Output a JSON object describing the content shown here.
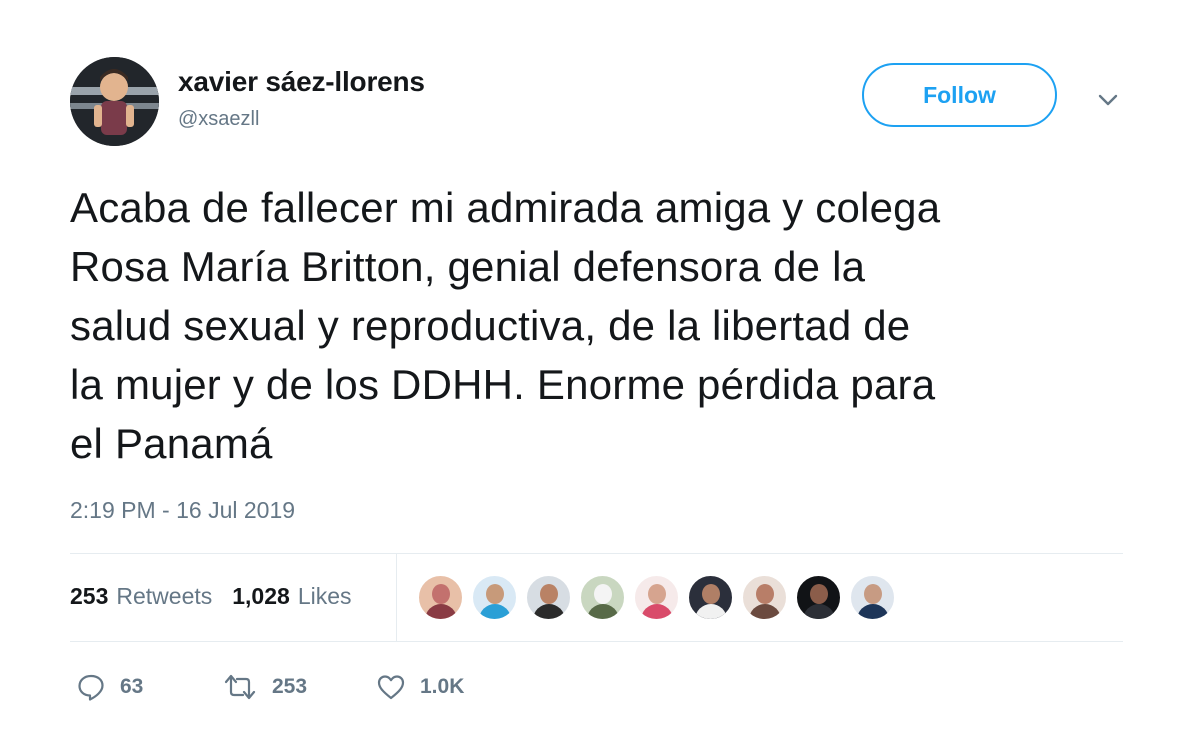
{
  "user": {
    "name": "xavier sáez-llorens",
    "handle": "@xsaezll"
  },
  "follow_label": "Follow",
  "tweet": {
    "text": "Acaba de fallecer mi admirada amiga y colega\nRosa María Britton, genial defensora de la\nsalud sexual y reproductiva, de la libertad de\nla mujer y de los DDHH. Enorme pérdida para\nel Panamá",
    "timestamp": "2:19 PM - 16 Jul 2019"
  },
  "stats": {
    "retweets_count": "253",
    "retweets_label": "Retweets",
    "likes_count": "1,028",
    "likes_label": "Likes"
  },
  "likers_count": 9,
  "actions": {
    "reply_count": "63",
    "retweet_count": "253",
    "like_count": "1.0K"
  },
  "colors": {
    "accent": "#1da1f2",
    "muted": "#657786",
    "text": "#14171a",
    "divider": "#e6ecf0"
  }
}
